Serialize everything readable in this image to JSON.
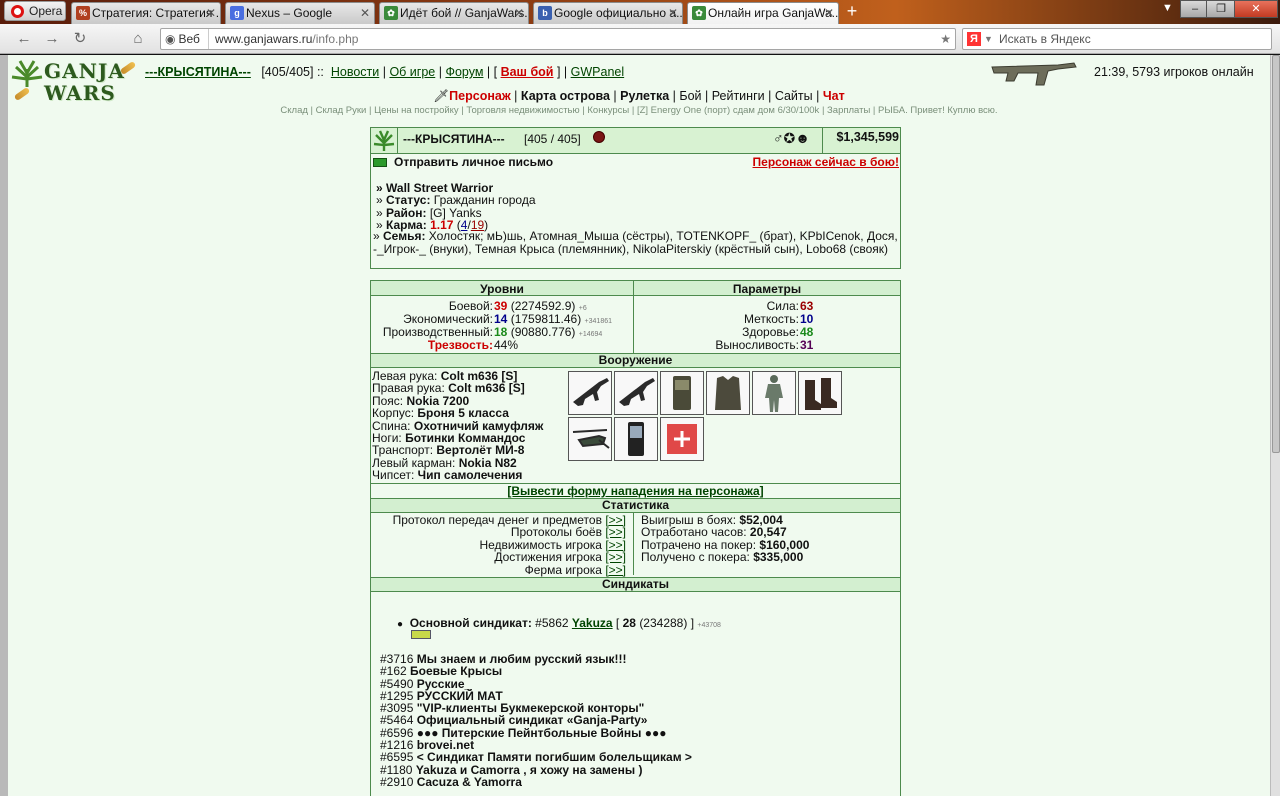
{
  "browser": {
    "opera_label": "Opera",
    "tabs": [
      {
        "title": "Стратегия: Стратегия ...",
        "fav": "%",
        "favcolor": "#b04020"
      },
      {
        "title": "Nexus – Google",
        "fav": "g",
        "favcolor": "#4a6ee0"
      },
      {
        "title": "Идёт бой // GanjaWars...",
        "fav": "",
        "favcolor": "#3a8a3a"
      },
      {
        "title": "Google официально а...",
        "fav": "b",
        "favcolor": "#3a60b0"
      },
      {
        "title": "Онлайн игра GanjaWa...",
        "fav": "",
        "favcolor": "#3a8a3a"
      }
    ],
    "web_label": "Веб",
    "url_host": "www.ganjawars.ru",
    "url_path": "/info.php",
    "search_placeholder": "Искать в Яндекс"
  },
  "header": {
    "logo_line1": "GANJA",
    "logo_line2": "WARS",
    "nick": "---КРЫСЯТИНА---",
    "hp": "[405/405]",
    "sep": "::",
    "links": [
      "Новости",
      "Об игре",
      "Форум"
    ],
    "war_link": "Ваш бой",
    "gwpanel": "GWPanel",
    "clock": "21:39, 5793 игроков онлайн"
  },
  "menu": {
    "items": [
      "Персонаж",
      "Карта острова",
      "Рулетка",
      "Бой",
      "Рейтинги",
      "Сайты",
      "Чат"
    ],
    "sub": "Склад | Склад Руки | Цены на постройку | Торговля недвижимостью | Конкурсы | [Z] Energy One (порт) сдам дом 6/30/100k | Зарплаты | РЫБА. Привет! Куплю всю."
  },
  "profile": {
    "nick": "---КРЫСЯТИНА---",
    "hp": "[405 / 405]",
    "money": "$1,345,599",
    "send_mail": "Отправить личное письмо",
    "in_battle": "Персонаж сейчас в бою!",
    "title": "Wall Street Warrior",
    "status_label": "Статус:",
    "status": "Гражданин города",
    "district_label": "Район:",
    "district": "[G] Yanks",
    "karma_label": "Карма:",
    "karma": "1.17",
    "karma_a": "4",
    "karma_b": "19",
    "family_label": "Семья:",
    "family": "Холостяк; мЬ)шь, Атомная_Мыша (сёстры), TOTENKOPF_ (брат), KPbICenok, Дося, -_Игрок-_ (внуки), Темная Крыса (племянник), NikolaPiterskiy (крёстный сын), Lobo68 (свояк)"
  },
  "levels": {
    "title": "Уровни",
    "rows": [
      {
        "label": "Боевой:",
        "lvl": "39",
        "exp": "(2274592.9)",
        "plus": "+6"
      },
      {
        "label": "Экономический:",
        "lvl": "14",
        "exp": "(1759811.46)",
        "plus": "+341861"
      },
      {
        "label": "Производственный:",
        "lvl": "18",
        "exp": "(90880.776)",
        "plus": "+14694"
      }
    ],
    "sober_label": "Трезвость:",
    "sober": "44%"
  },
  "params": {
    "title": "Параметры",
    "rows": [
      {
        "label": "Сила:",
        "value": "63"
      },
      {
        "label": "Меткость:",
        "value": "10"
      },
      {
        "label": "Здоровье:",
        "value": "48"
      },
      {
        "label": "Выносливость:",
        "value": "31"
      }
    ]
  },
  "armament": {
    "title": "Вооружение",
    "rows": [
      {
        "label": "Левая рука:",
        "value": "Colt m636 [S]"
      },
      {
        "label": "Правая рука:",
        "value": "Colt m636 [S]"
      },
      {
        "label": "Пояс:",
        "value": "Nokia 7200"
      },
      {
        "label": "Корпус:",
        "value": "Броня 5 класса"
      },
      {
        "label": "Спина:",
        "value": "Охотничий камуфляж"
      },
      {
        "label": "Ноги:",
        "value": "Ботинки Коммандос"
      },
      {
        "label": "Транспорт:",
        "value": "Вертолёт МИ-8"
      },
      {
        "label": "Левый карман:",
        "value": "Nokia N82"
      },
      {
        "label": "Чипсет:",
        "value": "Чип самолечения"
      }
    ],
    "attack_link": "[Вывести форму нападения на персонажа]"
  },
  "stats": {
    "title": "Статистика",
    "left": [
      "Протокол передач денег и предметов",
      "Протоколы боёв",
      "Недвижимость игрока",
      "Достижения игрока",
      "Ферма игрока"
    ],
    "go": "[>>]",
    "right": [
      {
        "label": "Выигрыш в боях:",
        "value": "$52,004"
      },
      {
        "label": "Отработано часов:",
        "value": "20,547"
      },
      {
        "label": "Потрачено на покер:",
        "value": "$160,000"
      },
      {
        "label": "Получено с покера:",
        "value": "$335,000"
      }
    ]
  },
  "syndicates": {
    "title": "Синдикаты",
    "main_label": "Основной синдикат:",
    "main_id": "#5862",
    "main_name": "Yakuza",
    "main_lvl": "28",
    "main_exp": "(234288)",
    "main_plus": "+43708",
    "list": [
      {
        "id": "#3716",
        "name": "Мы знаем и любим русский язык!!!"
      },
      {
        "id": "#162",
        "name": "Боевые Крысы"
      },
      {
        "id": "#5490",
        "name": "Русские_"
      },
      {
        "id": "#1295",
        "name": "РУССКИЙ МАТ"
      },
      {
        "id": "#3095",
        "name": "\"VIP-клиенты Букмекерской конторы\""
      },
      {
        "id": "#5464",
        "name": "Официальный синдикат «Ganja-Party»"
      },
      {
        "id": "#6596",
        "name": "●●● Питерские Пейнтбольные Войны ●●●"
      },
      {
        "id": "#1216",
        "name": "brovei.net"
      },
      {
        "id": "#6595",
        "name": "< Синдикат Памяти погибшим болельщикам >"
      },
      {
        "id": "#1180",
        "name": "Yakuza и Camorra , я хожу на замены )"
      },
      {
        "id": "#2910",
        "name": "Cacuza & Yamorra"
      }
    ]
  }
}
